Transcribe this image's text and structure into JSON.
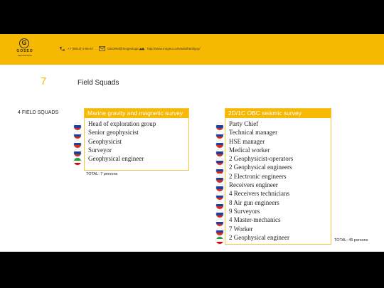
{
  "header": {
    "logo_letter": "G",
    "logo_word": "GOSEO",
    "logo_sub": "GEOPHYSICS",
    "phone": "+7 (8914) 3-65-67",
    "email": "GEORM@mogeologic.ru",
    "website": "http://www.mogeo.com/web/html/goy/"
  },
  "slide": {
    "number": "7",
    "title": "Field Squads",
    "squads_label": "4 FIELD SQUADS"
  },
  "marine": {
    "title": "Marine gravity and magnetic survey",
    "items": [
      {
        "label": "Head of exploration group",
        "flag": "russia-flag"
      },
      {
        "label": "Senior geophysicist",
        "flag": "russia-flag"
      },
      {
        "label": "Geophysicist",
        "flag": "russia-flag"
      },
      {
        "label": "Surveyor",
        "flag": "russia-flag"
      },
      {
        "label": "Geophysical engineer",
        "flag": "iran-flag"
      }
    ],
    "total": "TOTAL: 7 persons"
  },
  "seismic": {
    "title": "2D/1C OBC seismic survey",
    "items": [
      {
        "label": "Party Chief",
        "flag": "russia-flag"
      },
      {
        "label": "Technical manager",
        "flag": "russia-flag"
      },
      {
        "label": "HSE manager",
        "flag": "russia-flag"
      },
      {
        "label": "Medical worker",
        "flag": "russia-flag"
      },
      {
        "label": "2 Geophysicist-operators",
        "flag": "russia-flag"
      },
      {
        "label": "2 Geophysical engineers",
        "flag": "russia-flag"
      },
      {
        "label": "2 Electronic engineers",
        "flag": "russia-flag"
      },
      {
        "label": "Receivers engineer",
        "flag": "russia-flag"
      },
      {
        "label": "4 Receivers technicians",
        "flag": "russia-flag"
      },
      {
        "label": "8 Air gun engineers",
        "flag": "russia-flag"
      },
      {
        "label": "9 Surveyors",
        "flag": "russia-flag"
      },
      {
        "label": "4 Master-mechanics",
        "flag": "russia-flag"
      },
      {
        "label": "7 Worker",
        "flag": "russia-flag"
      },
      {
        "label": "2 Geophysical engineer",
        "flag": "iran-flag"
      }
    ],
    "total": "TOTAL: 45 persons"
  },
  "colors": {
    "accent": "#f6b800",
    "russia": [
      "#ffffff",
      "#1c3f9e",
      "#d52b1e"
    ],
    "iran": [
      "#239f40",
      "#ffffff",
      "#da0000"
    ]
  }
}
